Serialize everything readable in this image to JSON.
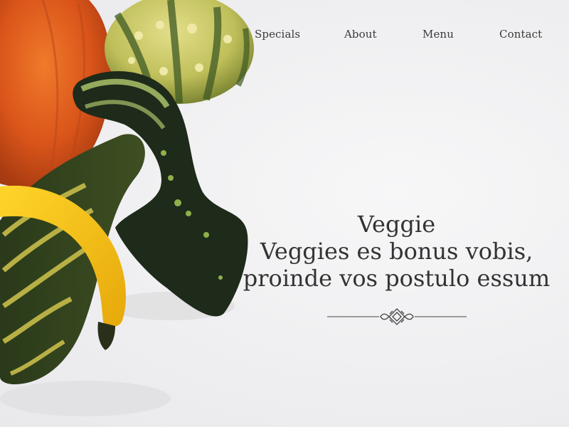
{
  "nav": {
    "items": [
      {
        "label": "Specials"
      },
      {
        "label": "About"
      },
      {
        "label": "Menu"
      },
      {
        "label": "Contact"
      }
    ]
  },
  "hero": {
    "title": "Veggie",
    "subtitle_line1": "Veggies es bonus vobis,",
    "subtitle_line2": "proinde vos postulo essum"
  },
  "colors": {
    "background": "#f2f2f3",
    "text": "#333333",
    "pumpkin": "#e0521a",
    "squash_yellow": "#f2c21a",
    "gourd_green": "#1f3a20"
  },
  "icons": {
    "divider": "ornamental-divider-icon"
  }
}
